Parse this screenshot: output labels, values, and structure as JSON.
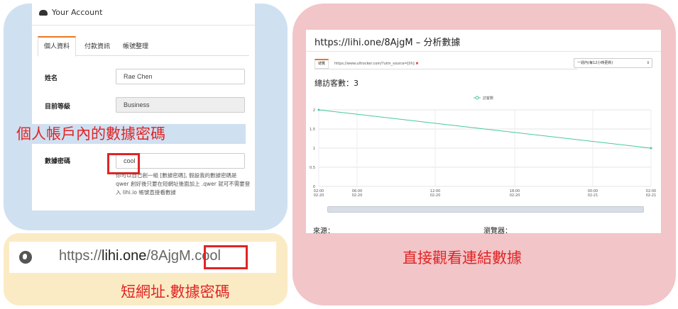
{
  "account": {
    "title": "Your Account",
    "tabs": [
      {
        "label": "個人資料",
        "active": true
      },
      {
        "label": "付款資訊",
        "active": false
      },
      {
        "label": "帳號整理",
        "active": false
      }
    ],
    "fields": {
      "name_label": "姓名",
      "name_value": "Rae Chen",
      "level_label": "目前等級",
      "level_value": "Business",
      "password_label": "數據密碼",
      "password_value": "cool"
    },
    "help_text": "你可以自己創一組 [數據密碼], 假設我的數據密碼是 qwer 創好後只要在短網址後面加上 .qwer 就可不需要登入 lihi.io 帳號直接看數據",
    "caption": "個人帳戶內的數據密碼"
  },
  "url_bar": {
    "prefix": "https://",
    "domain": "lihi.one",
    "path": "/8AjgM.cool",
    "caption": "短網址.數據密碼"
  },
  "analytics": {
    "title": "https://lihi.one/8AjgM – 分析數據",
    "tab_label": "總覽",
    "source_url": "https://www.ultrocker.com/?utm_source=[lih]",
    "remove_mark": "✖",
    "range_select": "一週內(每12小時更新)",
    "total_visits": "總訪客數：3",
    "source_label": "來源：",
    "browser_label": "瀏覽器：",
    "caption": "直接觀看連結數據"
  },
  "colors": {
    "accent": "#e87722",
    "highlight_red": "#e02424",
    "line": "#48c7a0"
  },
  "chart_data": {
    "type": "line",
    "series": [
      {
        "name": "訪客數",
        "x": [
          "02-20 02:00",
          "02-21 02:00"
        ],
        "values": [
          2,
          1
        ]
      }
    ],
    "ylim": [
      0,
      2
    ],
    "yticks": [
      "0",
      "0.5",
      "1",
      "1.5",
      "2"
    ],
    "xticks": [
      {
        "top": "02:00",
        "bottom": "02-20"
      },
      {
        "top": "06:00",
        "bottom": "02-20"
      },
      {
        "top": "12:00",
        "bottom": "02-20"
      },
      {
        "top": "18:00",
        "bottom": "02-20"
      },
      {
        "top": "00:00",
        "bottom": "02-21"
      },
      {
        "top": "02:00",
        "bottom": "02-21"
      }
    ],
    "legend": "top-center",
    "grid": true
  }
}
